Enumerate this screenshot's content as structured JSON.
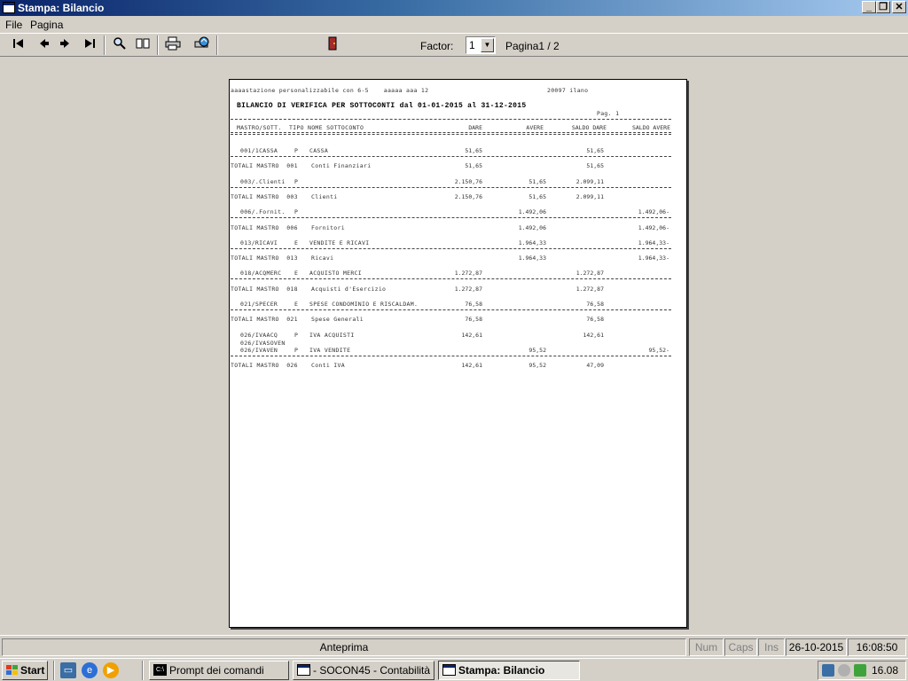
{
  "window": {
    "title": "Stampa: Bilancio"
  },
  "window_controls": {
    "minimize": "_",
    "restore": "❐",
    "close": "✕"
  },
  "menu": {
    "items": [
      "File",
      "Pagina"
    ]
  },
  "toolbar": {
    "icons": [
      "first-page-icon",
      "previous-page-icon",
      "next-page-icon",
      "last-page-icon",
      "zoom-icon",
      "two-pages-icon",
      "print-icon",
      "printer-setup-icon",
      "exit-door-icon"
    ],
    "factor_label": "Factor:",
    "factor_value": "1",
    "page_indicator": "Pagina1 / 2"
  },
  "report": {
    "header_company": "aaaastazione personalizzabile con 6-5    aaaaa aaa 12",
    "header_city": "20097 ilano",
    "title": "BILANCIO DI VERIFICA PER SOTTOCONTI dal 01-01-2015 al 31-12-2015",
    "page_label": "Pag. 1",
    "columns": {
      "code": "MASTRO/SOTT.",
      "type": "TIPO",
      "name": "NOME SOTTOCONTO",
      "dare": "DARE",
      "avere": "AVERE",
      "saldo_dare": "SALDO DARE",
      "saldo_avere": "SALDO AVERE"
    },
    "rows": [
      {
        "kind": "detail",
        "code": "001/1CASSA",
        "type": "P",
        "name": "CASSA",
        "dare": "51,65",
        "avere": "",
        "saldo_dare": "51,65",
        "saldo_avere": ""
      },
      {
        "kind": "total",
        "code": "TOTALI MASTRO  001",
        "type": "",
        "name": "Conti Finanziari",
        "dare": "51,65",
        "avere": "",
        "saldo_dare": "51,65",
        "saldo_avere": ""
      },
      {
        "kind": "detail",
        "code": "003/.Clienti",
        "type": "P",
        "name": "",
        "dare": "2.150,76",
        "avere": "51,65",
        "saldo_dare": "2.099,11",
        "saldo_avere": ""
      },
      {
        "kind": "total",
        "code": "TOTALI MASTRO  003",
        "type": "",
        "name": "Clienti",
        "dare": "2.150,76",
        "avere": "51,65",
        "saldo_dare": "2.099,11",
        "saldo_avere": ""
      },
      {
        "kind": "detail",
        "code": "006/.Fornit.",
        "type": "P",
        "name": "",
        "dare": "",
        "avere": "1.492,06",
        "saldo_dare": "",
        "saldo_avere": "1.492,06-"
      },
      {
        "kind": "total",
        "code": "TOTALI MASTRO  006",
        "type": "",
        "name": "Fornitori",
        "dare": "",
        "avere": "1.492,06",
        "saldo_dare": "",
        "saldo_avere": "1.492,06-"
      },
      {
        "kind": "detail",
        "code": "013/RICAVI",
        "type": "E",
        "name": "VENDITE E RICAVI",
        "dare": "",
        "avere": "1.964,33",
        "saldo_dare": "",
        "saldo_avere": "1.964,33-"
      },
      {
        "kind": "total",
        "code": "TOTALI MASTRO  013",
        "type": "",
        "name": "Ricavi",
        "dare": "",
        "avere": "1.964,33",
        "saldo_dare": "",
        "saldo_avere": "1.964,33-"
      },
      {
        "kind": "detail",
        "code": "018/ACQMERC",
        "type": "E",
        "name": "ACQUISTO MERCI",
        "dare": "1.272,87",
        "avere": "",
        "saldo_dare": "1.272,87",
        "saldo_avere": ""
      },
      {
        "kind": "total",
        "code": "TOTALI MASTRO  018",
        "type": "",
        "name": "Acquisti d'Esercizio",
        "dare": "1.272,87",
        "avere": "",
        "saldo_dare": "1.272,87",
        "saldo_avere": ""
      },
      {
        "kind": "detail",
        "code": "021/SPECER",
        "type": "E",
        "name": "SPESE CONDOMINIO E RISCALDAM.",
        "dare": "76,58",
        "avere": "",
        "saldo_dare": "76,58",
        "saldo_avere": ""
      },
      {
        "kind": "total",
        "code": "TOTALI MASTRO  021",
        "type": "",
        "name": "Spese Generali",
        "dare": "76,58",
        "avere": "",
        "saldo_dare": "76,58",
        "saldo_avere": ""
      },
      {
        "kind": "detail",
        "code": "026/IVAACQ",
        "type": "P",
        "name": "IVA ACQUISTI",
        "dare": "142,61",
        "avere": "",
        "saldo_dare": "142,61",
        "saldo_avere": ""
      },
      {
        "kind": "subline",
        "code": "026/IVASOVEN",
        "type": "",
        "name": "",
        "dare": "",
        "avere": "",
        "saldo_dare": "",
        "saldo_avere": ""
      },
      {
        "kind": "detail",
        "code": "026/IVAVEN",
        "type": "P",
        "name": "IVA VENDITE",
        "dare": "",
        "avere": "95,52",
        "saldo_dare": "",
        "saldo_avere": "95,52-"
      },
      {
        "kind": "total",
        "code": "TOTALI MASTRO  026",
        "type": "",
        "name": "Conti IVA",
        "dare": "142,61",
        "avere": "95,52",
        "saldo_dare": "47,09",
        "saldo_avere": ""
      }
    ]
  },
  "statusbar": {
    "mode": "Anteprima",
    "num": "Num",
    "caps": "Caps",
    "ins": "Ins",
    "date": "26-10-2015",
    "time": "16:08:50"
  },
  "taskbar": {
    "start_label": "Start",
    "tasks": [
      {
        "label": "Prompt dei comandi",
        "icon": "cmd-icon",
        "active": false
      },
      {
        "label": "- SOCON45 - Contabilità ...",
        "icon": "window-icon",
        "active": false
      },
      {
        "label": "Stampa: Bilancio",
        "icon": "window-icon",
        "active": true
      }
    ],
    "clock": "16.08"
  }
}
